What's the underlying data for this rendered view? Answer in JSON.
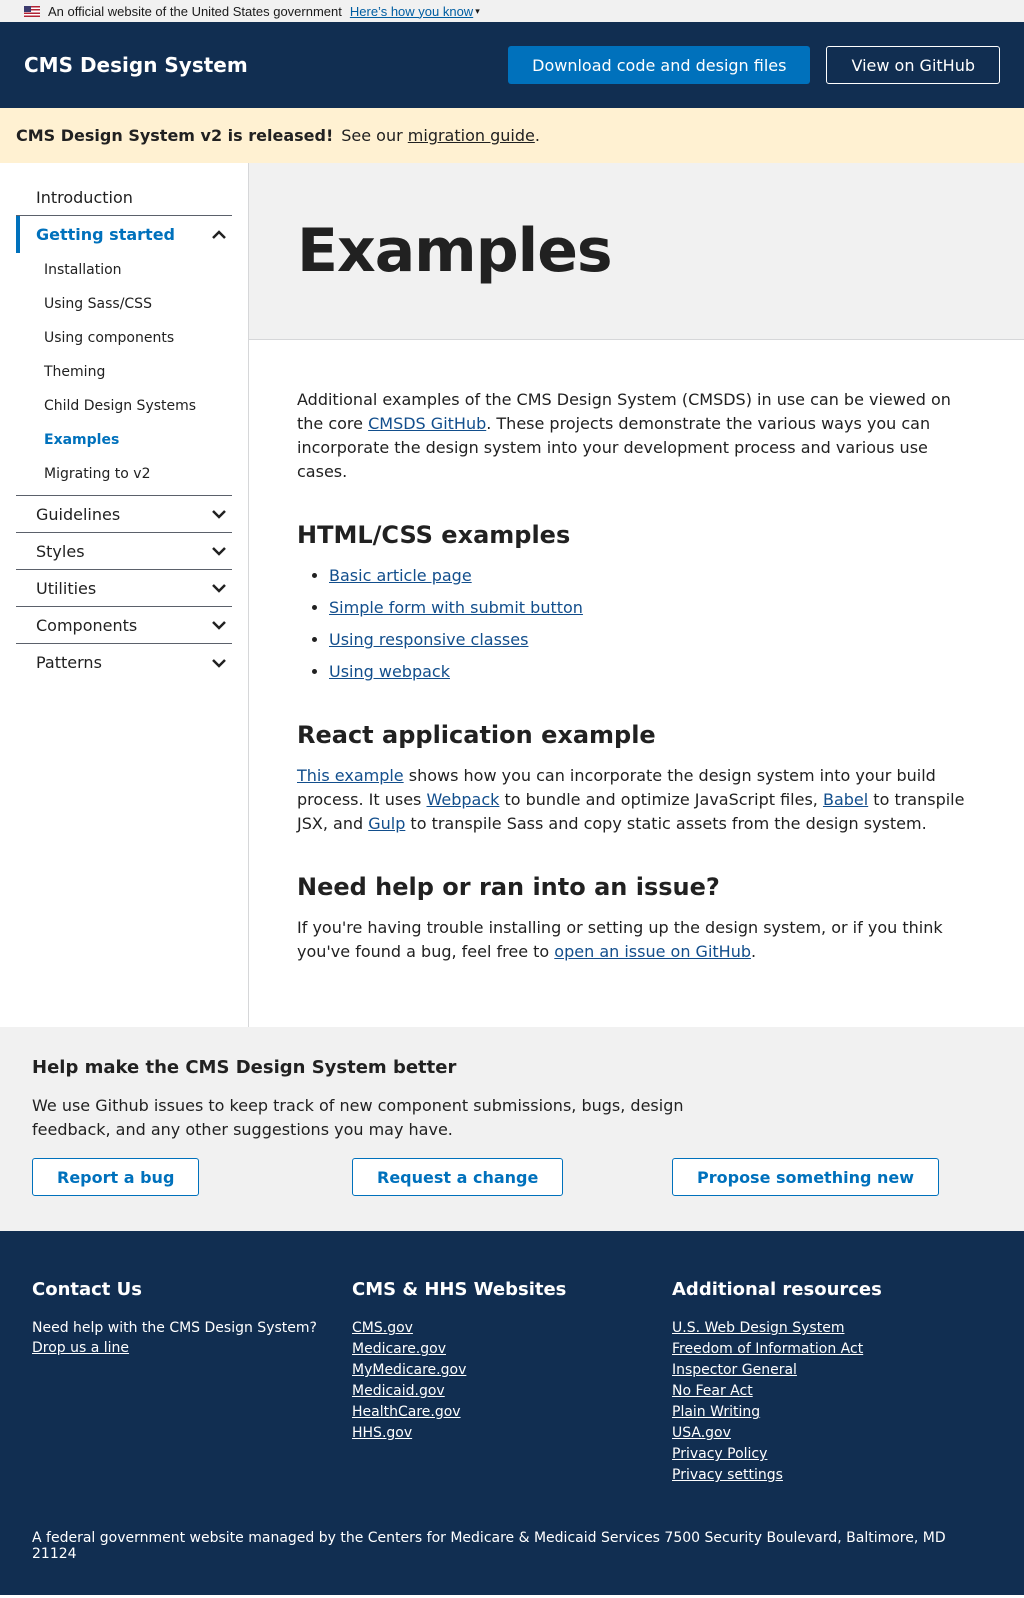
{
  "gov_banner": {
    "text": "An official website of the United States government",
    "link": "Here’s how you know"
  },
  "header": {
    "title": "CMS Design System",
    "download_label": "Download code and design files",
    "github_label": "View on GitHub"
  },
  "alert": {
    "strong": "CMS Design System v2 is released!",
    "text": "See our",
    "link": "migration guide",
    "period": "."
  },
  "sidebar": {
    "introduction": "Introduction",
    "getting_started": "Getting started",
    "subitems": [
      "Installation",
      "Using Sass/CSS",
      "Using components",
      "Theming",
      "Child Design Systems",
      "Examples",
      "Migrating to v2"
    ],
    "guidelines": "Guidelines",
    "styles": "Styles",
    "utilities": "Utilities",
    "components": "Components",
    "patterns": "Patterns"
  },
  "page": {
    "title": "Examples",
    "intro_1": "Additional examples of the CMS Design System (CMSDS) in use can be viewed on the core ",
    "intro_link": "CMSDS GitHub",
    "intro_2": ". These projects demonstrate the various ways you can incorporate the design system into your development process and various use cases.",
    "html_heading": "HTML/CSS examples",
    "html_links": [
      "Basic article page",
      "Simple form with submit button",
      "Using responsive classes",
      "Using webpack"
    ],
    "react_heading": "React application example",
    "react_link_1": "This example",
    "react_text_1": " shows how you can incorporate the design system into your build process. It uses ",
    "react_link_2": "Webpack",
    "react_text_2": " to bundle and optimize JavaScript files, ",
    "react_link_3": "Babel",
    "react_text_3": " to transpile JSX, and ",
    "react_link_4": "Gulp",
    "react_text_4": " to transpile Sass and copy static assets from the design system.",
    "help_heading": "Need help or ran into an issue?",
    "help_text_1": "If you're having trouble installing or setting up the design system, or if you think you've found a bug, feel free to ",
    "help_link": "open an issue on GitHub",
    "help_text_2": "."
  },
  "feedback": {
    "heading": "Help make the CMS Design System better",
    "text": "We use Github issues to keep track of new component submissions, bugs, design feedback, and any other suggestions you may have.",
    "report_bug": "Report a bug",
    "request_change": "Request a change",
    "propose_new": "Propose something new"
  },
  "footer": {
    "contact_heading": "Contact Us",
    "contact_text": "Need help with the CMS Design System?",
    "contact_link": "Drop us a line",
    "websites_heading": "CMS & HHS Websites",
    "websites": [
      "CMS.gov",
      "Medicare.gov",
      "MyMedicare.gov",
      "Medicaid.gov",
      "HealthCare.gov",
      "HHS.gov"
    ],
    "resources_heading": "Additional resources",
    "resources": [
      "U.S. Web Design System",
      "Freedom of Information Act",
      "Inspector General",
      "No Fear Act",
      "Plain Writing",
      "USA.gov",
      "Privacy Policy",
      "Privacy settings"
    ],
    "bottom": "A federal government website managed by the Centers for Medicare & Medicaid Services 7500 Security Boulevard, Baltimore, MD 21124"
  },
  "colors": {
    "navy": "#112e51",
    "primary": "#0071bc",
    "alert_bg": "#fff1d2",
    "gray_bg": "#f1f1f1"
  }
}
